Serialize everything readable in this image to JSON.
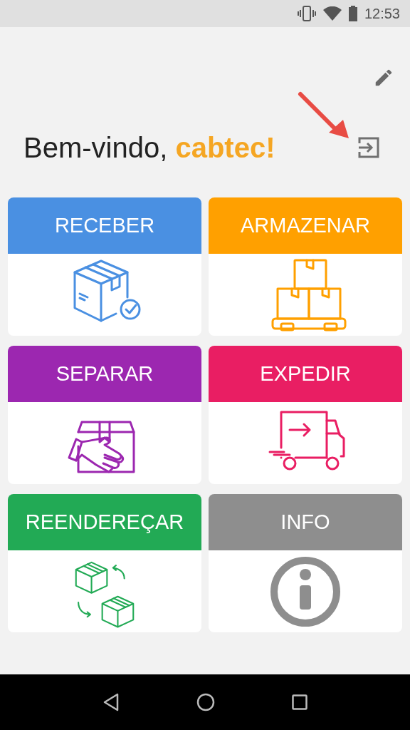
{
  "status_bar": {
    "time": "12:53"
  },
  "header": {
    "greeting": "Bem-vindo, **cabtec!**"
  },
  "cards": [
    {
      "label": "RECEBER",
      "color": "#4a90e2",
      "kind": "receive"
    },
    {
      "label": "ARMAZENAR",
      "color": "#ffa000",
      "kind": "store"
    },
    {
      "label": "SEPARAR",
      "color": "#9c27b0",
      "kind": "pick"
    },
    {
      "label": "EXPEDIR",
      "color": "#e91e63",
      "kind": "ship"
    },
    {
      "label": "REENDEREÇAR",
      "color": "#22aa55",
      "kind": "relocate"
    },
    {
      "label": "INFO",
      "color": "#8e8e8e",
      "kind": "info"
    }
  ]
}
